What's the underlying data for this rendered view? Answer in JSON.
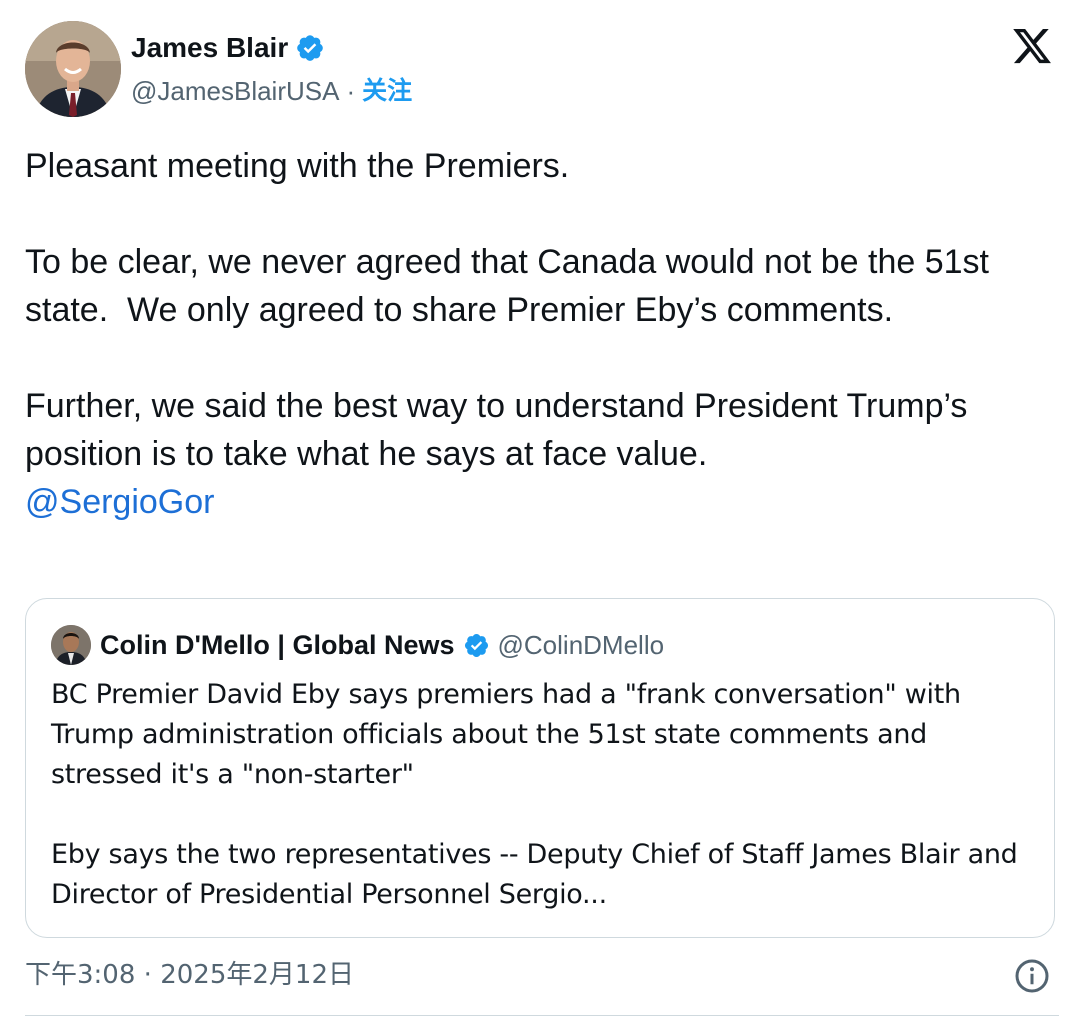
{
  "author": {
    "name": "James Blair",
    "handle": "@JamesBlairUSA",
    "separator": "·",
    "follow_label": "关注",
    "verified": true
  },
  "icons": {
    "verified": "verified-badge-icon",
    "logo": "x-logo-icon",
    "info": "info-icon"
  },
  "colors": {
    "verified": "#1d9bf0",
    "link": "#1d6fd6",
    "secondary_text": "#536471"
  },
  "tweet": {
    "paragraphs": [
      "Pleasant meeting with the Premiers.",
      "To be clear, we never agreed that Canada would not be the 51st state.  We only agreed to share Premier Eby’s comments.",
      "Further, we said the best way to understand President Trump’s position is to take what he says at face value."
    ],
    "mention": "@SergioGor"
  },
  "quote": {
    "name": "Colin D'Mello | Global News",
    "handle": "@ColinDMello",
    "verified": true,
    "paragraphs": [
      "BC Premier David Eby says premiers had a \"frank conversation\" with Trump administration officials about the 51st state comments and stressed it's a \"non-starter\"",
      "Eby says the two representatives -- Deputy Chief of Staff James Blair and Director of Presidential Personnel Sergio..."
    ]
  },
  "meta": {
    "time": "下午3:08",
    "separator": "·",
    "date": "2025年2月12日"
  }
}
